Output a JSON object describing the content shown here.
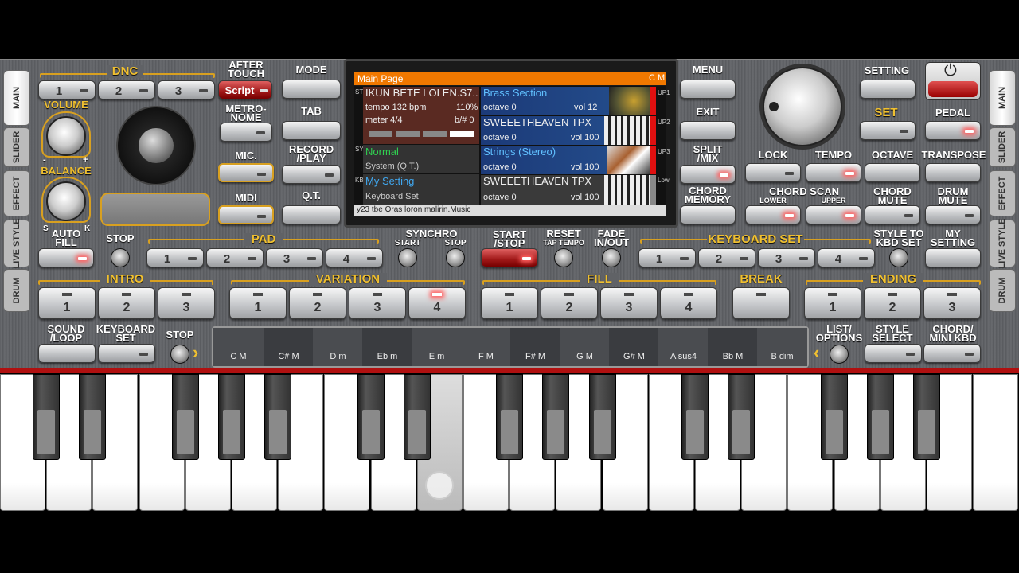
{
  "tabs_left": [
    "MAIN",
    "SLIDER",
    "EFFECT",
    "LIVE STYLE",
    "DRUM"
  ],
  "tabs_right": [
    "MAIN",
    "SLIDER",
    "EFFECT",
    "LIVE STYLE",
    "DRUM"
  ],
  "dnc": {
    "title": "DNC",
    "b1": "1",
    "b2": "2",
    "b3": "3",
    "script": "Script"
  },
  "labels": {
    "aftertouch": "AFTER\nTOUCH",
    "metronome": "METRO-\nNOME",
    "mic": "MIC.",
    "midi": "MIDI",
    "volume": "VOLUME",
    "balance": "BALANCE",
    "bal_minus": "-",
    "bal_plus": "+",
    "s": "S",
    "k": "K",
    "mode": "MODE",
    "tab": "TAB",
    "record": "RECORD\n/PLAY",
    "qt": "Q.T.",
    "menu": "MENU",
    "exit": "EXIT",
    "split": "SPLIT\n/MIX",
    "chordmem": "CHORD\nMEMORY",
    "setting": "SETTING",
    "set": "SET",
    "pedal": "PEDAL",
    "lock": "LOCK",
    "tempo": "TEMPO",
    "octave": "OCTAVE",
    "transpose": "TRANSPOSE",
    "chordscan": "CHORD SCAN",
    "lower": "LOWER",
    "upper": "UPPER",
    "chordmute": "CHORD\nMUTE",
    "drummute": "DRUM\nMUTE",
    "autofill": "AUTO\nFILL",
    "stop": "STOP",
    "pad": "PAD",
    "synchro": "SYNCHRO",
    "sstart": "START",
    "sstop": "STOP",
    "startstop": "START\n/STOP",
    "reset": "RESET",
    "taptempo": "TAP TEMPO",
    "fade": "FADE\nIN/OUT",
    "keyboardset": "KEYBOARD SET",
    "styletokbd": "STYLE TO\nKBD SET",
    "mysetting": "MY\nSETTING",
    "intro": "INTRO",
    "variation": "VARIATION",
    "fill": "FILL",
    "break": "BREAK",
    "ending": "ENDING",
    "soundloop": "SOUND\n/LOOP",
    "kbdset": "KEYBOARD\nSET",
    "stop2": "STOP",
    "listopt": "LIST/\nOPTIONS",
    "stylesel": "STYLE\nSELECT",
    "chordmini": "CHORD/\nMINI KBD"
  },
  "numbers": [
    "1",
    "2",
    "3",
    "4"
  ],
  "screen": {
    "title": "Main Page",
    "key": "C M",
    "style_name": "IKUN BETE LOLEN.S7..",
    "tempo": "tempo 132 bpm",
    "pct": "110%",
    "meter": "meter 4/4",
    "bsharp": "b/# 0",
    "sys_name": "Normal",
    "sys_sub": "System (Q.T.)",
    "kbd_name": "My Setting",
    "kbd_sub": "Keyboard Set",
    "up1_name": "Brass Section",
    "up1_oct": "octave 0",
    "up1_vol": "vol 12",
    "up2_name": "SWEEETHEAVEN TPX",
    "up2_oct": "octave 0",
    "up2_vol": "vol 100",
    "up3_name": "Strings (Stereo)",
    "up3_oct": "octave 0",
    "up3_vol": "vol 100",
    "low_name": "SWEEETHEAVEN TPX",
    "low_oct": "octave 0",
    "low_vol": "vol 100",
    "footer": "y23 tbe Oras loron malirin.Music",
    "side_style": "STYLE",
    "side_sys": "SYS",
    "side_kbd": "KBD",
    "up1": "UP1",
    "up2": "UP2",
    "up3": "UP3",
    "low": "Low"
  },
  "chords": [
    "C M",
    "C# M",
    "D m",
    "Eb m",
    "E m",
    "F M",
    "F# M",
    "G M",
    "G# M",
    "A sus4",
    "Bb M",
    "B dim"
  ],
  "colors": {
    "accent": "#f0c030",
    "screen_header": "#f07800",
    "led_on": "#ff6060"
  }
}
